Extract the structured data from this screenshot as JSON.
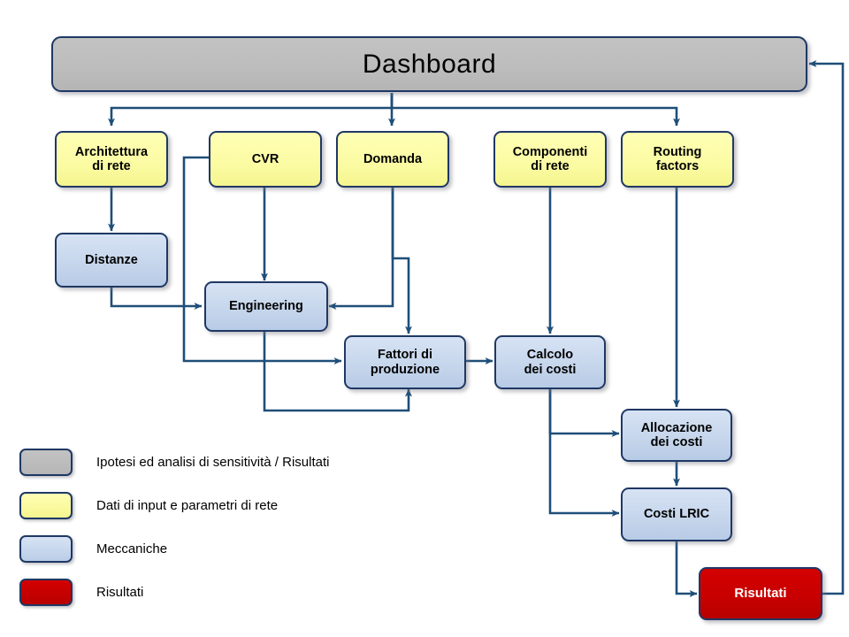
{
  "diagram": {
    "title": "Dashboard",
    "nodes": [
      {
        "id": "dashboard",
        "label": "Dashboard",
        "type": "assumptions"
      },
      {
        "id": "architettura",
        "label": "Architettura\ndi rete",
        "type": "input"
      },
      {
        "id": "cvr",
        "label": "CVR",
        "type": "input"
      },
      {
        "id": "domanda",
        "label": "Domanda",
        "type": "input"
      },
      {
        "id": "componenti",
        "label": "Componenti\ndi rete",
        "type": "input"
      },
      {
        "id": "routing",
        "label": "Routing\nfactors",
        "type": "input"
      },
      {
        "id": "distanze",
        "label": "Distanze",
        "type": "mechanics"
      },
      {
        "id": "engineering",
        "label": "Engineering",
        "type": "mechanics"
      },
      {
        "id": "fattori",
        "label": "Fattori di\nproduzione",
        "type": "mechanics"
      },
      {
        "id": "calcolo",
        "label": "Calcolo\ndei costi",
        "type": "mechanics"
      },
      {
        "id": "allocazione",
        "label": "Allocazione\ndei costi",
        "type": "mechanics"
      },
      {
        "id": "lric",
        "label": "Costi LRIC",
        "type": "mechanics"
      },
      {
        "id": "risultati",
        "label": "Risultati",
        "type": "results"
      }
    ],
    "edges": [
      {
        "from": "dashboard",
        "to": "architettura"
      },
      {
        "from": "dashboard",
        "to": "domanda"
      },
      {
        "from": "dashboard",
        "to": "routing"
      },
      {
        "from": "architettura",
        "to": "distanze"
      },
      {
        "from": "distanze",
        "to": "engineering"
      },
      {
        "from": "cvr",
        "to": "engineering"
      },
      {
        "from": "cvr",
        "to": "fattori"
      },
      {
        "from": "domanda",
        "to": "engineering"
      },
      {
        "from": "domanda",
        "to": "fattori"
      },
      {
        "from": "engineering",
        "to": "fattori"
      },
      {
        "from": "fattori",
        "to": "calcolo"
      },
      {
        "from": "componenti",
        "to": "calcolo"
      },
      {
        "from": "routing",
        "to": "allocazione"
      },
      {
        "from": "calcolo",
        "to": "allocazione"
      },
      {
        "from": "calcolo",
        "to": "lric"
      },
      {
        "from": "allocazione",
        "to": "lric"
      },
      {
        "from": "lric",
        "to": "risultati"
      },
      {
        "from": "risultati",
        "to": "dashboard"
      }
    ]
  },
  "legend": {
    "items": [
      {
        "color": "#bdbdbd",
        "label": "Ipotesi ed analisi di sensitività / Risultati"
      },
      {
        "color": "#f8f89a",
        "label": "Dati di input e parametri di rete"
      },
      {
        "color": "#c6d6ec",
        "label": "Meccaniche"
      },
      {
        "color": "#c80000",
        "label": "Risultati"
      }
    ]
  },
  "colors": {
    "border": "#1F3864",
    "wire": "#1F4E79",
    "assumptions": "#bdbdbd",
    "input": "#f8f89a",
    "mechanics": "#c6d6ec",
    "results": "#c80000"
  }
}
